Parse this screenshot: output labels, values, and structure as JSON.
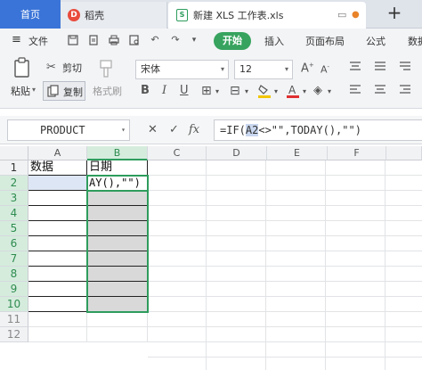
{
  "tabs": {
    "home": "首页",
    "daoke": "稻壳",
    "file": "新建 XLS 工作表.xls",
    "add": "+"
  },
  "menu": {
    "file": "文件",
    "start": "开始",
    "insert": "插入",
    "page_layout": "页面布局",
    "formula": "公式",
    "data": "数据"
  },
  "ribbon": {
    "cut": "剪切",
    "paste": "粘贴",
    "copy": "复制",
    "format_painter": "格式刷",
    "font_name": "宋体",
    "font_size": "12"
  },
  "formula_bar": {
    "name_box": "PRODUCT",
    "formula_prefix": "=IF(",
    "formula_ref": "A2",
    "formula_rest": "<>\"\",TODAY(),\"\")"
  },
  "columns": [
    "A",
    "B",
    "C",
    "D",
    "E",
    "F"
  ],
  "rows": [
    "1",
    "2",
    "3",
    "4",
    "5",
    "6",
    "7",
    "8",
    "9",
    "10",
    "11",
    "12"
  ],
  "cells": {
    "A1": "数据",
    "B1": "日期",
    "B2": "AY(),\"\")"
  },
  "colors": {
    "accent_green": "#2e9c5d",
    "home_tab": "#3a74d8",
    "selection_fill": "#d9d9d9"
  }
}
